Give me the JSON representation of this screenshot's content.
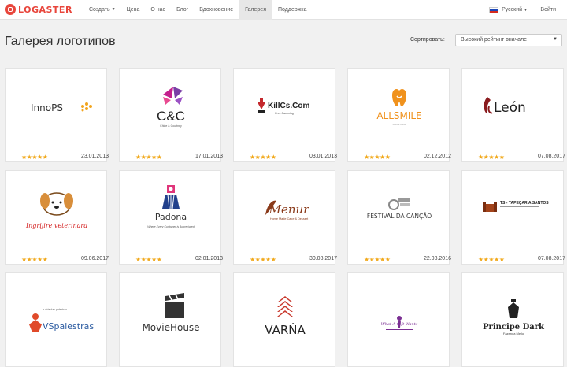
{
  "brand": {
    "name": "LOGASTER"
  },
  "nav": [
    {
      "label": "Создать",
      "caret": true,
      "active": false
    },
    {
      "label": "Цена",
      "active": false
    },
    {
      "label": "О нас",
      "active": false
    },
    {
      "label": "Блог",
      "active": false
    },
    {
      "label": "Вдохновение",
      "active": false
    },
    {
      "label": "Галерея",
      "active": true
    },
    {
      "label": "Поддержка",
      "active": false
    }
  ],
  "language": {
    "label": "Русский"
  },
  "login": {
    "label": "Войти"
  },
  "page": {
    "title": "Галерея логотипов"
  },
  "sort": {
    "label": "Сортировать:",
    "selected": "Высокий рейтинг вначале"
  },
  "cards": [
    {
      "logo": "InnoPS",
      "date": "23.01.2013",
      "rating": 5
    },
    {
      "logo": "C&C",
      "tagline": "Chloe & Courtney",
      "date": "17.01.2013",
      "rating": 5
    },
    {
      "logo": "KillCs.Com",
      "tagline": "Free Gamming",
      "date": "03.01.2013",
      "rating": 5
    },
    {
      "logo": "ALLSMILE",
      "tagline": "Dental Clinic",
      "date": "02.12.2012",
      "rating": 5
    },
    {
      "logo": "León",
      "date": "07.08.2017",
      "rating": 5
    },
    {
      "logo": "Ingrijire veterinara",
      "date": "09.06.2017",
      "rating": 5
    },
    {
      "logo": "Padona",
      "tagline": "Where Every Customer is Appreciated",
      "date": "02.01.2013",
      "rating": 5
    },
    {
      "logo": "Menur",
      "tagline": "Home Made Cake & Dessert",
      "date": "30.08.2017",
      "rating": 5
    },
    {
      "logo": "FESTIVAL DA CANÇÃO",
      "date": "22.08.2016",
      "rating": 5
    },
    {
      "logo": "TS - TAPEÇARIA SANTOS",
      "date": "07.08.2017",
      "rating": 5
    },
    {
      "logo": "VSpalestras",
      "tagline": "a vida das palestras",
      "date": "",
      "rating": 0
    },
    {
      "logo": "MovieHouse",
      "date": "",
      "rating": 0
    },
    {
      "logo": "VARŃA",
      "date": "",
      "rating": 0
    },
    {
      "logo": "What A Gift Wants",
      "date": "",
      "rating": 0
    },
    {
      "logo": "Principe Dark",
      "tagline": "Fazenda Mello",
      "date": "",
      "rating": 0
    }
  ]
}
